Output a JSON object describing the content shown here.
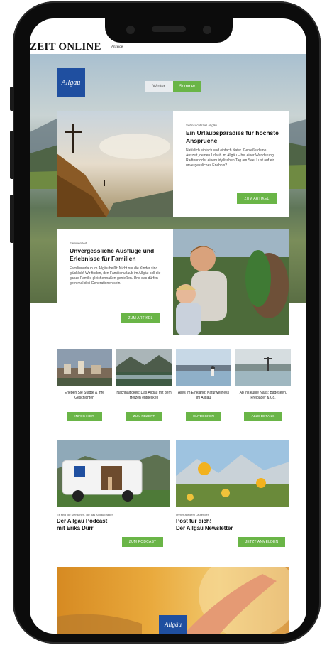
{
  "header": {
    "logo": "ZEIT ONLINE",
    "ad_label": "Anzeige"
  },
  "hero": {
    "brand": "Allgäu",
    "season_tabs": [
      {
        "label": "Winter",
        "active": false
      },
      {
        "label": "Sommer",
        "active": true
      }
    ],
    "card": {
      "eyebrow": "Sehnsuchtsziel Allgäu",
      "title": "Ein Urlaubsparadies für höchste Ansprüche",
      "text": "Natürlich einfach und einfach Natur. Genieße deine Auszeit, deinen Urlaub im Allgäu – bei einer Wanderung, Radtour oder einem idyllischen Tag am See. Lust auf ein unvergessliches Erlebnis?",
      "button": "ZUM ARTIKEL"
    }
  },
  "family": {
    "eyebrow": "Familienzeit",
    "title": "Unvergessliche Ausflüge und Erlebnisse für Familien",
    "text": "Familienurlaub im Allgäu heißt: Nicht nur die Kinder sind glücklich! Wir finden, den Familienurlaub im Allgäu soll die ganze Familie gleichermaßen genießen. Und das dürfen gern mal drei Generationen sein.",
    "button": "ZUM ARTIKEL"
  },
  "tiles": [
    {
      "text": "Erleben Sie Städte & ihre Geschichten",
      "button": "INFOS HIER"
    },
    {
      "text": "Nachhaltigkeit: Das Allgäu mit dem Herzen entdecken",
      "button": "ZUM REZEPT"
    },
    {
      "text": "Alles im Einklang: Naturwellness im Allgäu",
      "button": "ENTDECKEN"
    },
    {
      "text": "Ab ins kühle Nass: Badeseen, Freibäder & Co.",
      "button": "ALLE DETAILS"
    }
  ],
  "podcast": {
    "eyebrow": "Es sind die Menschen, die das Allgäu prägen",
    "title_line1": "Der Allgäu Podcast –",
    "title_line2": "mit Erika Dürr",
    "button": "ZUM PODCAST"
  },
  "newsletter": {
    "eyebrow": "Immer auf dem Laufenden",
    "title_line1": "Post für dich!",
    "title_line2": "Der Allgäu Newsletter",
    "button": "JETZT ANMELDEN"
  },
  "footer_brand": "Allgäu",
  "colors": {
    "accent_green": "#6ab547",
    "brand_blue": "#1f4fa0"
  }
}
